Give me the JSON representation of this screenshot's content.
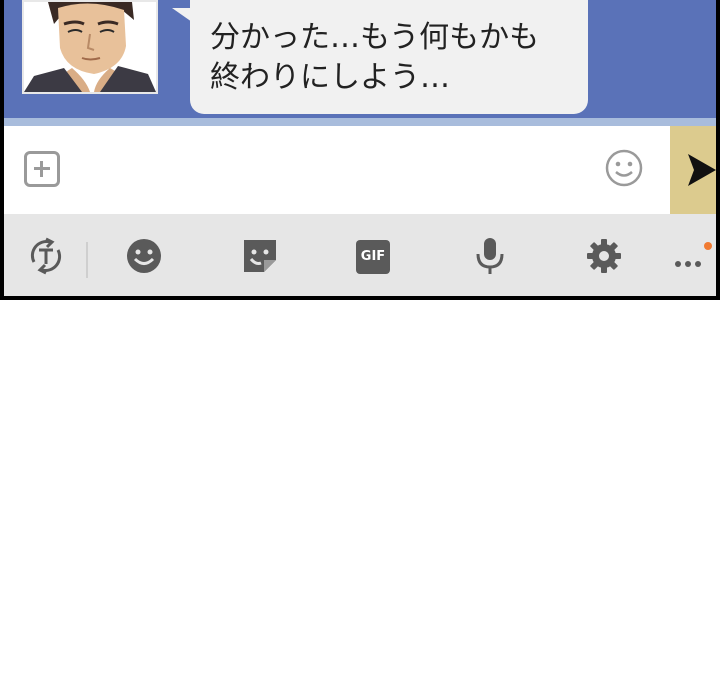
{
  "conversation": {
    "message": {
      "text": "分かった…もう何もかも\n終わりにしよう…"
    }
  },
  "composer": {
    "input_value": "",
    "attach_icon": "plus-square-icon",
    "emoji_icon": "smiley-icon",
    "send_icon": "send-arrow-icon"
  },
  "toolbar": {
    "items": [
      {
        "icon": "translate-icon"
      },
      {
        "icon": "emoji-face-icon"
      },
      {
        "icon": "sticker-icon"
      },
      {
        "icon": "gif-icon",
        "label": "GIF"
      },
      {
        "icon": "microphone-icon"
      },
      {
        "icon": "settings-gear-icon"
      },
      {
        "icon": "more-icon"
      }
    ]
  },
  "colors": {
    "chat_background": "#5a72b8",
    "bubble": "#f1f1f1",
    "send_button": "#dccb8e",
    "toolbar": "#e6e6e6",
    "notification_dot": "#f07a32"
  }
}
